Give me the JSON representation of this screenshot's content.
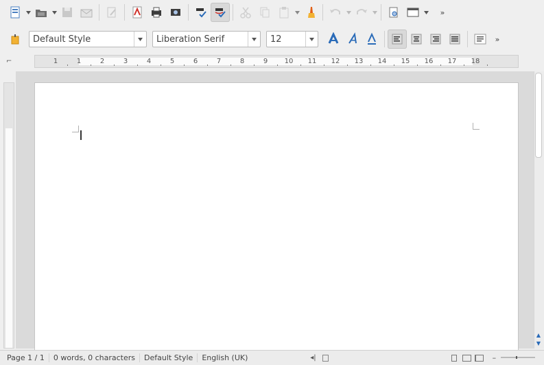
{
  "toolbar": {
    "style": {
      "value": "Default Style"
    },
    "font": {
      "value": "Liberation Serif"
    },
    "size": {
      "value": "12"
    }
  },
  "ruler": {
    "numbers": [
      "1",
      "1",
      "2",
      "3",
      "4",
      "5",
      "6",
      "7",
      "8",
      "9",
      "10",
      "11",
      "12",
      "13",
      "14",
      "15",
      "16",
      "17",
      "18"
    ]
  },
  "statusbar": {
    "page": "Page 1 / 1",
    "words": "0 words, 0 characters",
    "style": "Default Style",
    "language": "English (UK)"
  },
  "colors": {
    "accent": "#2a6bb8",
    "highlight": "#e25f16"
  }
}
